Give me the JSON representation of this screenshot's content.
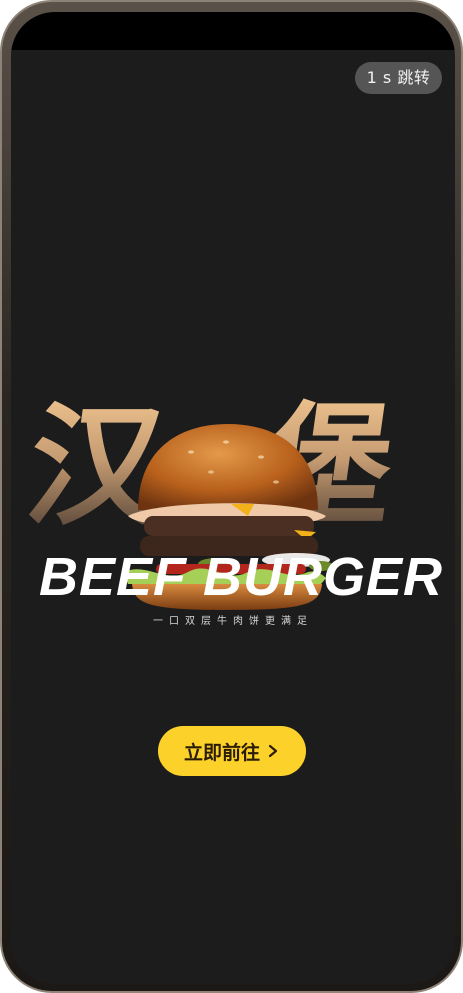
{
  "skip": {
    "label": "1 s 跳转"
  },
  "hero": {
    "cn_title": "汉堡",
    "en_title": "BEEF BURGER",
    "tagline": "一口双层牛肉饼更满足"
  },
  "cta": {
    "label": "立即前往",
    "icon": "chevron-right-icon"
  },
  "colors": {
    "background": "#1c1c1c",
    "cta_bg": "#fbd12a",
    "cta_text": "#2a1c05",
    "title_gradient_top": "#f0c48f",
    "title_gradient_bottom": "#4a3b30"
  }
}
